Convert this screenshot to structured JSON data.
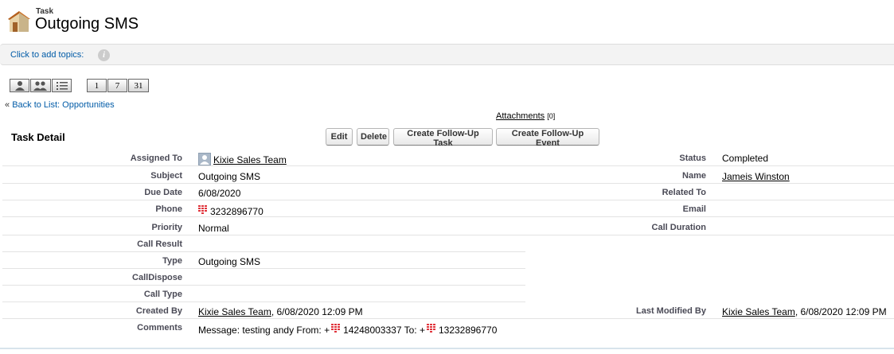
{
  "header": {
    "object_type": "Task",
    "title": "Outgoing SMS",
    "icon": "task-house-icon"
  },
  "topics": {
    "link_text": "Click to add topics:",
    "info_icon": "i"
  },
  "calendar_views": {
    "buttons": [
      {
        "name": "single-user-view",
        "icon": "person-icon"
      },
      {
        "name": "multi-user-view",
        "icon": "people-icon"
      },
      {
        "name": "list-view",
        "icon": "list-icon"
      }
    ],
    "day_label": "1",
    "week_label": "7",
    "month_label": "31"
  },
  "back_link": {
    "prefix": "« ",
    "text": "Back to List: Opportunities"
  },
  "attachments": {
    "label": "Attachments",
    "count": "[0]"
  },
  "detail": {
    "title": "Task Detail",
    "buttons": {
      "edit": "Edit",
      "delete": "Delete",
      "follow_up_task": "Create Follow-Up Task",
      "follow_up_event": "Create Follow-Up Event"
    },
    "fields": {
      "assigned_to": {
        "label": "Assigned To",
        "value": "Kixie Sales Team"
      },
      "status": {
        "label": "Status",
        "value": "Completed"
      },
      "subject": {
        "label": "Subject",
        "value": "Outgoing SMS"
      },
      "name": {
        "label": "Name",
        "value": "Jameis Winston"
      },
      "due_date": {
        "label": "Due Date",
        "value": "6/08/2020"
      },
      "related_to": {
        "label": "Related To",
        "value": ""
      },
      "phone": {
        "label": "Phone",
        "value": "3232896770"
      },
      "email": {
        "label": "Email",
        "value": ""
      },
      "priority": {
        "label": "Priority",
        "value": "Normal"
      },
      "call_duration": {
        "label": "Call Duration",
        "value": ""
      },
      "call_result": {
        "label": "Call Result",
        "value": ""
      },
      "type": {
        "label": "Type",
        "value": "Outgoing SMS"
      },
      "call_dispose": {
        "label": "CallDispose",
        "value": ""
      },
      "call_type": {
        "label": "Call Type",
        "value": ""
      },
      "created_by": {
        "label": "Created By",
        "user": "Kixie Sales Team",
        "date": ", 6/08/2020 12:09 PM"
      },
      "last_modified_by": {
        "label": "Last Modified By",
        "user": "Kixie Sales Team",
        "date": ", 6/08/2020 12:09 PM"
      },
      "comments": {
        "label": "Comments",
        "part1": "Message: testing andy From: +",
        "number1": "14248003337",
        "part2": " To: +",
        "number2": "13232896770"
      }
    }
  },
  "colors": {
    "link_blue": "#015ba7",
    "label_gray": "#4a4a56",
    "phone_icon_red": "#e0343c"
  }
}
